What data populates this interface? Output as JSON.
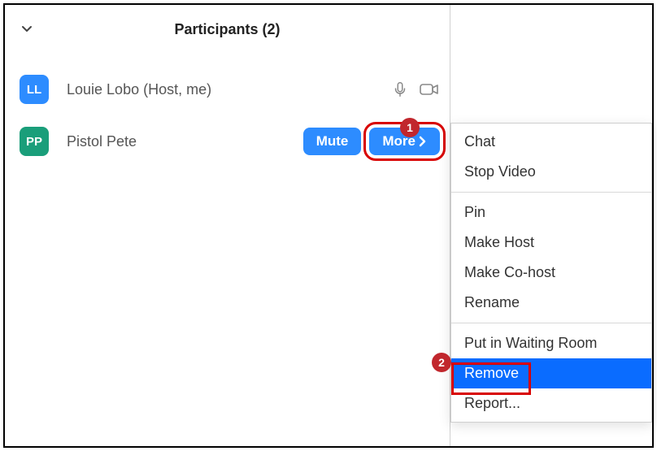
{
  "header": {
    "title": "Participants (2)"
  },
  "participants": [
    {
      "initials": "LL",
      "name": "Louie Lobo (Host, me)",
      "avatar_color": "blue",
      "show_icons": true,
      "show_buttons": false
    },
    {
      "initials": "PP",
      "name": "Pistol Pete",
      "avatar_color": "green",
      "show_icons": false,
      "show_buttons": true
    }
  ],
  "buttons": {
    "mute": "Mute",
    "more": "More"
  },
  "menu": {
    "group1": [
      "Chat",
      "Stop Video"
    ],
    "group2": [
      "Pin",
      "Make Host",
      "Make Co-host",
      "Rename"
    ],
    "group3": [
      "Put in Waiting Room",
      "Remove",
      "Report..."
    ],
    "selected": "Remove"
  },
  "annotations": {
    "badge1": "1",
    "badge2": "2"
  }
}
